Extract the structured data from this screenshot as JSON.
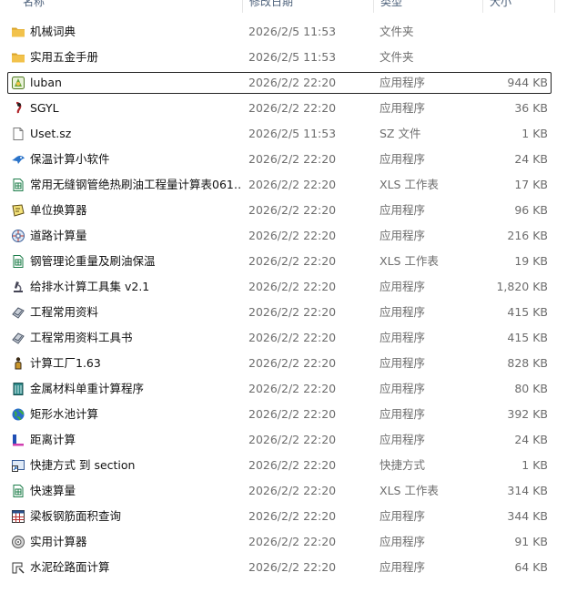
{
  "columns": {
    "name": "名称",
    "date": "修改日期",
    "type": "类型",
    "size": "大小"
  },
  "files": [
    {
      "name": "机械词典",
      "date": "2026/2/5 11:53",
      "type": "文件夹",
      "size": "",
      "icon": "folder-icon"
    },
    {
      "name": "实用五金手册",
      "date": "2026/2/5 11:53",
      "type": "文件夹",
      "size": "",
      "icon": "folder-icon"
    },
    {
      "name": "luban",
      "date": "2026/2/2 22:20",
      "type": "应用程序",
      "size": "944 KB",
      "icon": "app-luban-icon"
    },
    {
      "name": "SGYL",
      "date": "2026/2/2 22:20",
      "type": "应用程序",
      "size": "36 KB",
      "icon": "app-sgyl-icon"
    },
    {
      "name": "Uset.sz",
      "date": "2026/2/5 11:53",
      "type": "SZ 文件",
      "size": "1 KB",
      "icon": "file-icon"
    },
    {
      "name": "保温计算小软件",
      "date": "2026/2/2 22:20",
      "type": "应用程序",
      "size": "24 KB",
      "icon": "app-bird-icon"
    },
    {
      "name": "常用无缝钢管绝热刷油工程量计算表061…",
      "date": "2026/2/2 22:20",
      "type": "XLS 工作表",
      "size": "17 KB",
      "icon": "xls-icon"
    },
    {
      "name": "单位换算器",
      "date": "2026/2/2 22:20",
      "type": "应用程序",
      "size": "96 KB",
      "icon": "app-converter-icon"
    },
    {
      "name": "道路计算量",
      "date": "2026/2/2 22:20",
      "type": "应用程序",
      "size": "216 KB",
      "icon": "app-road-icon"
    },
    {
      "name": "钢管理论重量及刷油保温",
      "date": "2026/2/2 22:20",
      "type": "XLS 工作表",
      "size": "19 KB",
      "icon": "xls-icon"
    },
    {
      "name": "给排水计算工具集 v2.1",
      "date": "2026/2/2 22:20",
      "type": "应用程序",
      "size": "1,820 KB",
      "icon": "app-microscope-icon"
    },
    {
      "name": "工程常用资料",
      "date": "2026/2/2 22:20",
      "type": "应用程序",
      "size": "415 KB",
      "icon": "app-book-icon"
    },
    {
      "name": "工程常用资料工具书",
      "date": "2026/2/2 22:20",
      "type": "应用程序",
      "size": "415 KB",
      "icon": "app-book-icon"
    },
    {
      "name": "计算工厂1.63",
      "date": "2026/2/2 22:20",
      "type": "应用程序",
      "size": "828 KB",
      "icon": "app-figure-icon"
    },
    {
      "name": "金属材料单重计算程序",
      "date": "2026/2/2 22:20",
      "type": "应用程序",
      "size": "80 KB",
      "icon": "app-calculator-icon"
    },
    {
      "name": "矩形水池计算",
      "date": "2026/2/2 22:20",
      "type": "应用程序",
      "size": "392 KB",
      "icon": "app-globe-icon"
    },
    {
      "name": "距离计算",
      "date": "2026/2/2 22:20",
      "type": "应用程序",
      "size": "24 KB",
      "icon": "app-distance-icon"
    },
    {
      "name": "快捷方式 到 section",
      "date": "2026/2/2 22:20",
      "type": "快捷方式",
      "size": "1 KB",
      "icon": "shortcut-icon"
    },
    {
      "name": "快速算量",
      "date": "2026/2/2 22:20",
      "type": "XLS 工作表",
      "size": "314 KB",
      "icon": "xls-icon"
    },
    {
      "name": "梁板钢筋面积查询",
      "date": "2026/2/2 22:20",
      "type": "应用程序",
      "size": "344 KB",
      "icon": "app-grid-icon"
    },
    {
      "name": "实用计算器",
      "date": "2026/2/2 22:20",
      "type": "应用程序",
      "size": "91 KB",
      "icon": "app-disc-icon"
    },
    {
      "name": "水泥砼路面计算",
      "date": "2026/2/2 22:20",
      "type": "应用程序",
      "size": "64 KB",
      "icon": "app-pavement-icon"
    }
  ],
  "focused_index": 2,
  "colors": {
    "folder": "#f2c24b",
    "folder_dark": "#d9a42a",
    "xls_green": "#1d7d4a",
    "header_text": "#4c607a",
    "secondary_text": "#6d6d6d"
  }
}
